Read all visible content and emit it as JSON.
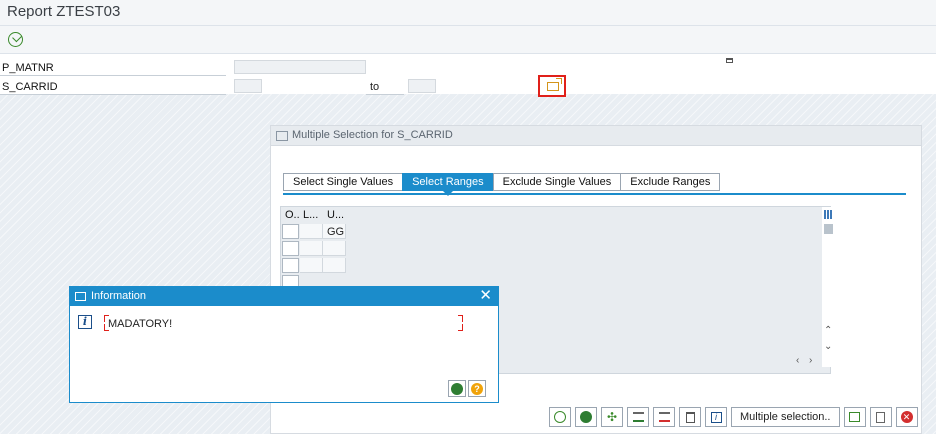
{
  "window": {
    "title": "Report ZTEST03"
  },
  "toolbar": {
    "execute_icon": "execute-icon"
  },
  "selection": {
    "p_matnr_label": "P_MATNR",
    "s_carrid_label": "S_CARRID",
    "to_label": "to",
    "multiple_selection_icon": "multiple-selection-icon"
  },
  "multi_select": {
    "title": "Multiple Selection for S_CARRID",
    "tabs": [
      "Select Single Values",
      "Select Ranges",
      "Exclude Single Values",
      "Exclude Ranges"
    ],
    "active_tab": "Select Ranges",
    "grid": {
      "headers": [
        "O..",
        "L...",
        "U..."
      ],
      "rows": [
        [
          "",
          "",
          "GG"
        ]
      ]
    },
    "buttons": {
      "multiple_selection_label": "Multiple selection.."
    }
  },
  "info_dialog": {
    "title": "Information",
    "message": "MADATORY!",
    "close": "✕"
  },
  "colors": {
    "accent": "#1b8ccb",
    "highlight": "#e0201a",
    "ok": "#2e7d32",
    "help": "#f0a30a",
    "cancel": "#d32f2f"
  }
}
